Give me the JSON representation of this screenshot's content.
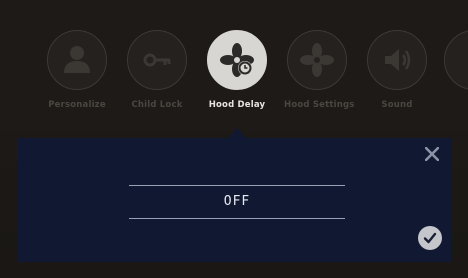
{
  "menu": {
    "items": [
      {
        "label": "Personalize",
        "icon": "person-icon",
        "active": false
      },
      {
        "label": "Child Lock",
        "icon": "key-icon",
        "active": false
      },
      {
        "label": "Hood Delay",
        "icon": "fan-timer-icon",
        "active": true
      },
      {
        "label": "Hood Settings",
        "icon": "fan-icon",
        "active": false
      },
      {
        "label": "Sound",
        "icon": "speaker-icon",
        "active": false
      }
    ]
  },
  "panel": {
    "value": "OFF",
    "close_icon": "close-icon",
    "confirm_icon": "checkmark-icon"
  },
  "colors": {
    "panel_bg": "#101832",
    "active_circle": "#d8d6d3",
    "inactive_label": "#4a4640"
  }
}
